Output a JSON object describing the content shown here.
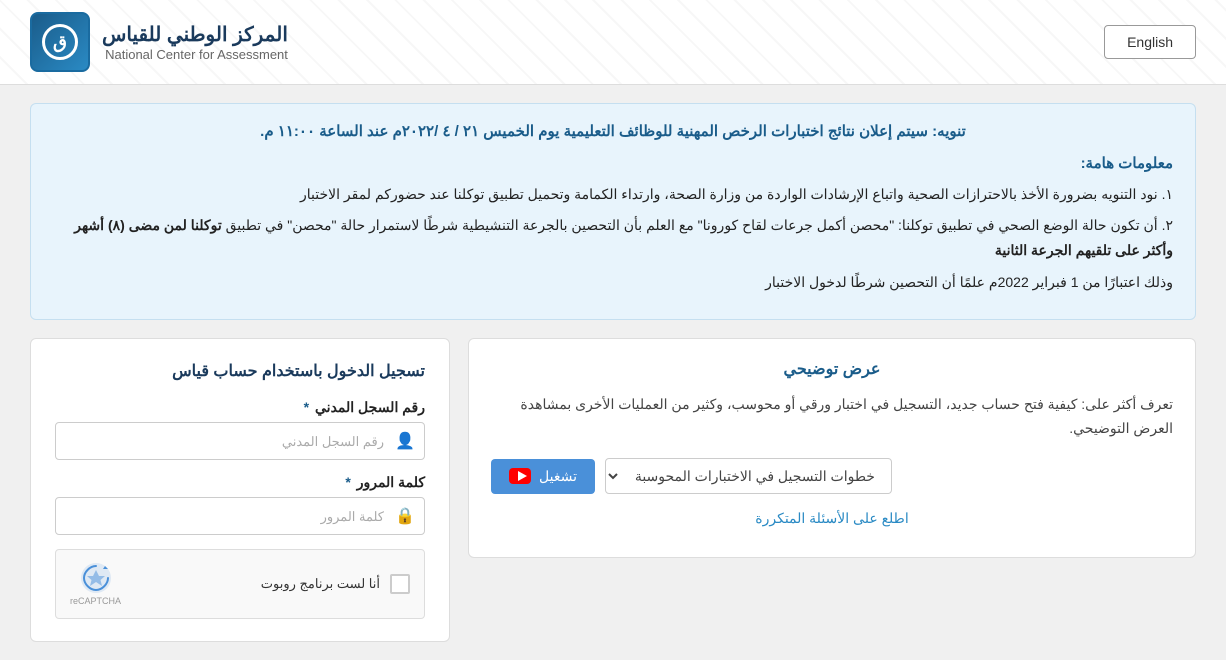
{
  "header": {
    "english_button": "English",
    "logo_arabic": "المركز الوطني للقياس",
    "logo_english": "National Center for Assessment",
    "logo_symbol": "ق"
  },
  "notice": {
    "title": "تنويه: سيتم إعلان نتائج اختبارات الرخص المهنية للوظائف التعليمية يوم الخميس ٢١ / ٤ /٢٠٢٢م عند الساعة ١١:٠٠ م.",
    "section_title": "معلومات هامة:",
    "item1": "١. نود التنويه بضرورة الأخذ بالاحترازات الصحية واتباع الإرشادات الواردة من وزارة الصحة، وارتداء الكمامة وتحميل تطبيق توكلنا عند حضوركم لمقر الاختبار",
    "item2_prefix": "٢. أن تكون حالة الوضع الصحي في تطبيق توكلنا: \"محصن أكمل جرعات لقاح كورونا\" مع العلم بأن التحصين بالجرعة التنشيطية شرطًا لاستمرار حالة \"محصن\" في تطبيق",
    "item2_bold": "توكلنا لمن مضى (٨) أشهر وأكثر على تلقيهم الجرعة الثانية",
    "item3": "وذلك اعتبارًا من 1 فبراير 2022م علمًا أن التحصين شرطًا لدخول الاختبار"
  },
  "demo": {
    "title": "عرض توضيحي",
    "description": "تعرف أكثر على: كيفية فتح حساب جديد، التسجيل في اختبار ورقي أو محوسب، وكثير من العمليات الأخرى بمشاهدة العرض التوضيحي.",
    "dropdown_placeholder": "خطوات التسجيل في الاختبارات المحوسبة",
    "play_button": "تشغيل",
    "faq_link": "اطلع على الأسئلة المتكررة"
  },
  "login": {
    "title": "تسجيل الدخول باستخدام حساب قياس",
    "id_label": "رقم السجل المدني",
    "id_required": "*",
    "id_placeholder": "رقم السجل المدني",
    "password_label": "كلمة المرور",
    "password_required": "*",
    "password_placeholder": "كلمة المرور",
    "recaptcha_label": "أنا لست برنامج روبوت",
    "recaptcha_subtext": "reCAPTCHA"
  }
}
